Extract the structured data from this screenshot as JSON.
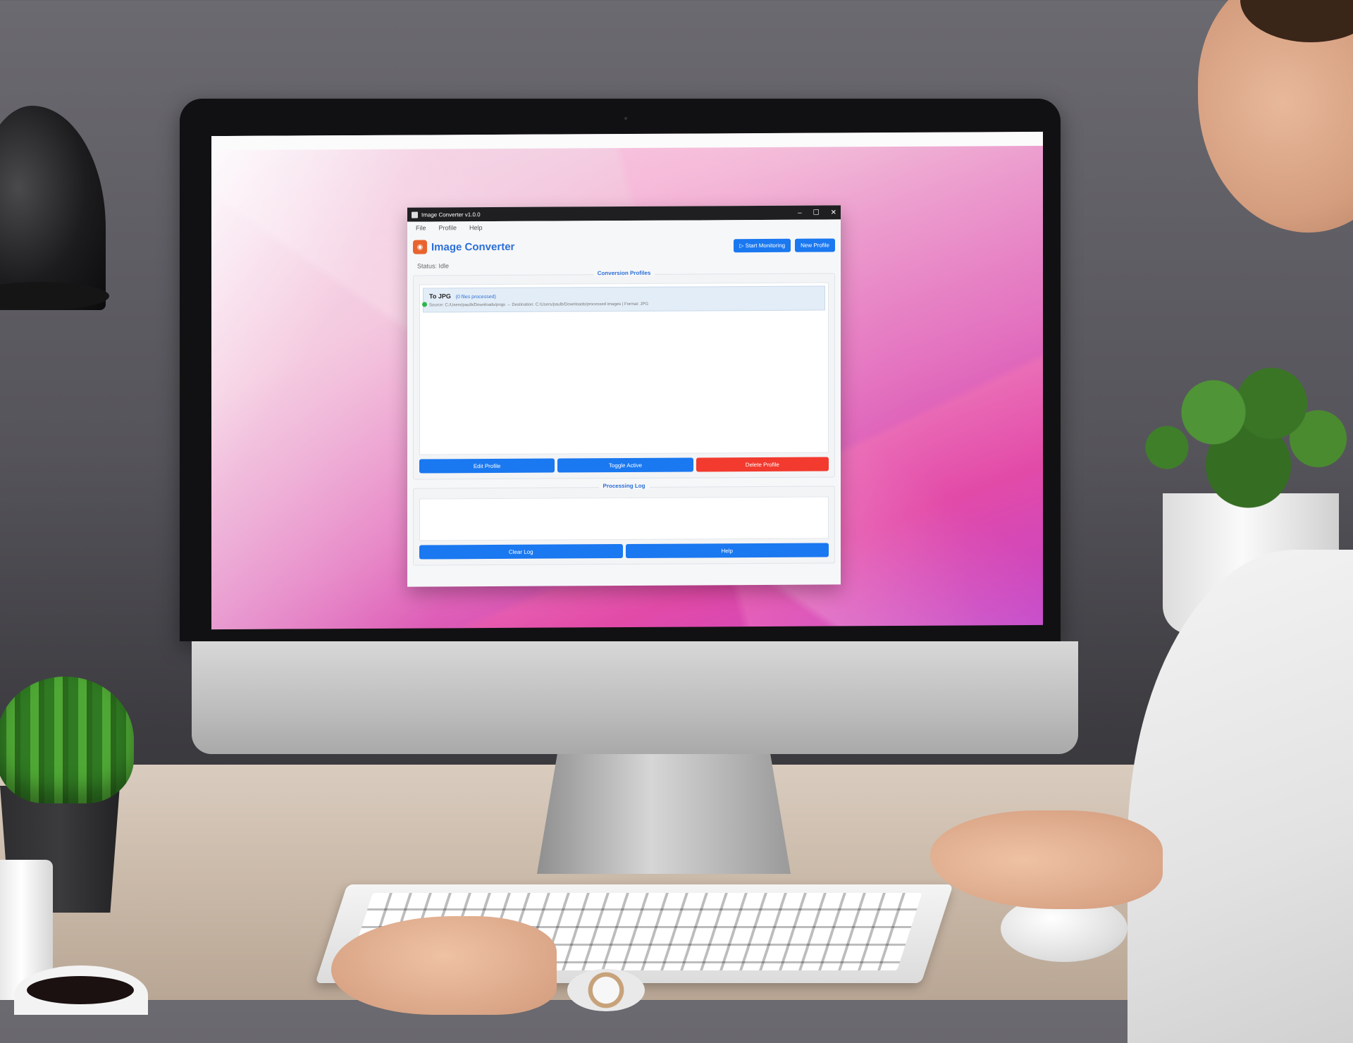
{
  "app": {
    "window_title": "Image Converter v1.0.0",
    "title": "Image Converter",
    "status": "Status: Idle"
  },
  "menu": [
    "File",
    "Profile",
    "Help"
  ],
  "window_controls": {
    "minimize": "–",
    "maximize": "☐",
    "close": "✕"
  },
  "header_buttons": {
    "start_monitoring": "▷ Start Monitoring",
    "new_profile": "New Profile"
  },
  "profiles_section": {
    "title": "Conversion Profiles",
    "items": [
      {
        "name": "To JPG",
        "count": "(0 files processed)",
        "details": "Source: C:/Users/paulb/Downloads/pngs → Destination: C:/Users/paulb/Downloads/processed images | Format: JPG"
      }
    ],
    "edit_label": "Edit Profile",
    "toggle_label": "Toggle Active",
    "delete_label": "Delete Profile"
  },
  "log_section": {
    "title": "Processing Log",
    "clear_label": "Clear Log",
    "help_label": "Help"
  },
  "colors": {
    "accent": "#1a78f0",
    "danger": "#f23a2f",
    "active_dot": "#2fb54a",
    "title": "#2b6fd6"
  }
}
